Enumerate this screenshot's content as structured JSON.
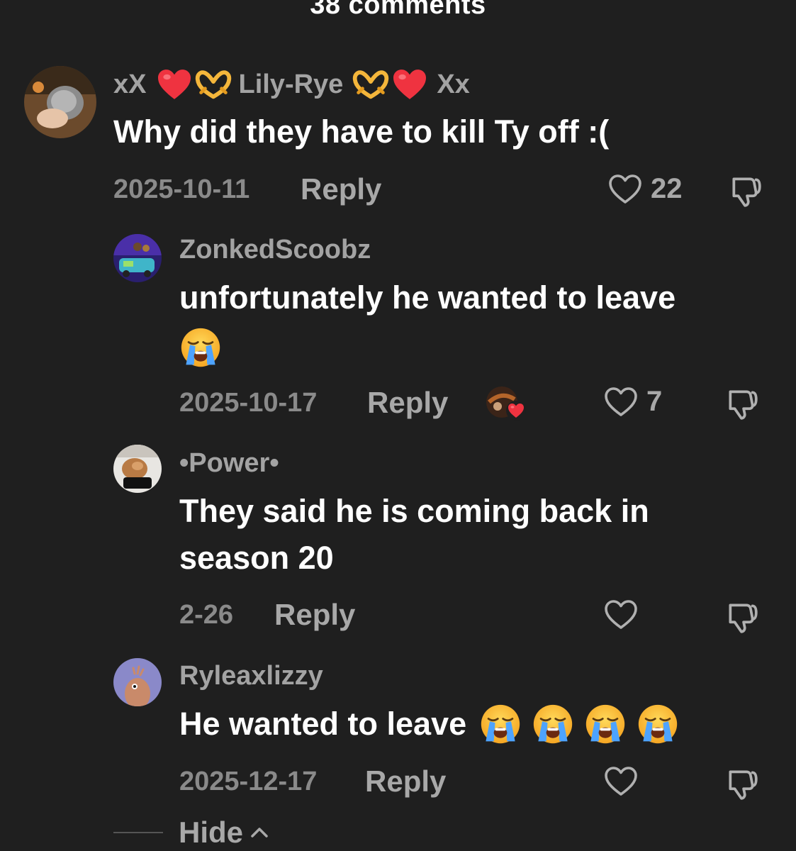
{
  "header": {
    "title": "38 comments"
  },
  "comments": [
    {
      "username": "xX ❤️🫶 Lily-Rye 🫶❤️ Xx",
      "username_parts": [
        "xX",
        "Lily-Rye",
        "Xx"
      ],
      "text": "Why did they have to kill Ty off :(",
      "date": "2025-10-11",
      "reply_label": "Reply",
      "likes": "22"
    },
    {
      "username": "ZonkedScoobz",
      "text": "unfortunately he wanted to leave",
      "text_emoji": "😭",
      "date": "2025-10-17",
      "reply_label": "Reply",
      "likes": "7",
      "liked_by_creator": true
    },
    {
      "username": "•Power•",
      "text_line1": "They said he is coming back in",
      "text_line2": "season 20",
      "date": "2-26",
      "reply_label": "Reply",
      "likes": ""
    },
    {
      "username": "Ryleaxlizzy",
      "text": "He wanted to leave",
      "text_emoji": "😭 😭 😭 😭",
      "date": "2025-12-17",
      "reply_label": "Reply",
      "likes": ""
    }
  ],
  "hide": {
    "label": "Hide"
  },
  "colors": {
    "background": "#1f1f1f",
    "username": "#a3a3a3",
    "text": "#ffffff",
    "meta": "#8a8a8a",
    "heart_red": "#ef3340"
  },
  "icons": {
    "like": "heart-outline-icon",
    "dislike": "thumbs-down-outline-icon",
    "hide": "chevron-up-icon",
    "emoji_cry": "loudly-crying-face-icon",
    "emoji_heart": "red-heart-icon",
    "emoji_hands": "heart-hands-icon"
  }
}
